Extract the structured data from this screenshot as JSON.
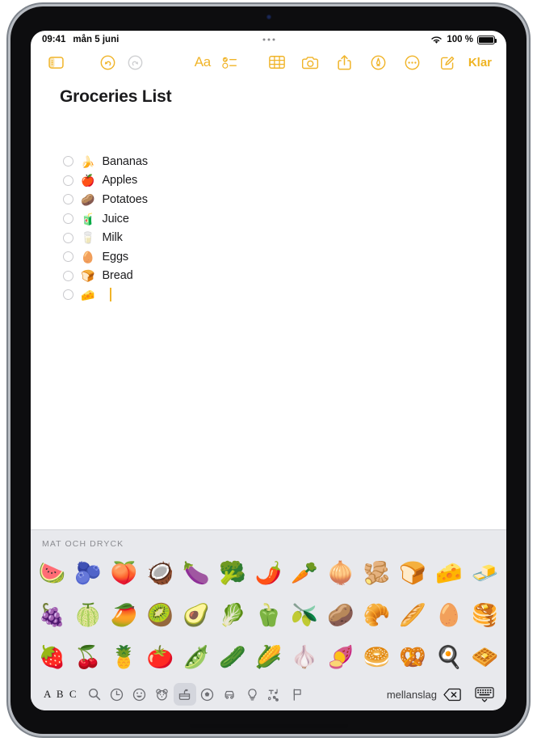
{
  "status_bar": {
    "time": "09:41",
    "date": "mån 5 juni",
    "wifi_icon": "wifi-icon",
    "battery_percent": "100 %",
    "battery_icon": "battery-icon",
    "multitask_icon": "multitasking-dots-icon"
  },
  "toolbar": {
    "sidebar_icon": "sidebar-toggle-icon",
    "undo_icon": "undo-icon",
    "redo_icon": "redo-icon",
    "format_label": "Aa",
    "checklist_icon": "checklist-icon",
    "table_icon": "table-icon",
    "camera_icon": "camera-icon",
    "share_icon": "share-icon",
    "markup_icon": "markup-pen-icon",
    "more_icon": "more-ellipsis-icon",
    "compose_icon": "compose-icon",
    "done_label": "Klar",
    "accent_color": "#f0b429"
  },
  "note": {
    "title": "Groceries List",
    "items": [
      {
        "emoji": "🍌",
        "text": "Bananas",
        "checked": false
      },
      {
        "emoji": "🍎",
        "text": "Apples",
        "checked": false
      },
      {
        "emoji": "🥔",
        "text": "Potatoes",
        "checked": false
      },
      {
        "emoji": "🧃",
        "text": "Juice",
        "checked": false
      },
      {
        "emoji": "🥛",
        "text": "Milk",
        "checked": false
      },
      {
        "emoji": "🥚",
        "text": "Eggs",
        "checked": false
      },
      {
        "emoji": "🍞",
        "text": "Bread",
        "checked": false
      },
      {
        "emoji": "🧀",
        "text": "",
        "checked": false
      }
    ]
  },
  "keyboard": {
    "section_title": "MAT OCH DRYCK",
    "emoji_rows": [
      [
        "🍉",
        "🫐",
        "🍑",
        "🥥",
        "🍆",
        "🥦",
        "🌶️",
        "🥕",
        "🧅",
        "🫚",
        "🍞",
        "🧀",
        "🧈"
      ],
      [
        "🍇",
        "🍈",
        "🥭",
        "🥝",
        "🥑",
        "🥬",
        "🫑",
        "🫒",
        "🥔",
        "🥐",
        "🥖",
        "🥚",
        "🥞"
      ],
      [
        "🍓",
        "🍒",
        "🍍",
        "🍅",
        "🫛",
        "🥒",
        "🌽",
        "🧄",
        "🍠",
        "🥯",
        "🥨",
        "🍳",
        "🧇"
      ]
    ],
    "abc_label": "A B C",
    "space_label": "mellanslag",
    "categories": [
      {
        "name": "search-icon",
        "glyph": "",
        "selected": false
      },
      {
        "name": "recents-clock-icon",
        "glyph": "",
        "selected": false
      },
      {
        "name": "smileys-icon",
        "glyph": "",
        "selected": false
      },
      {
        "name": "animals-icon",
        "glyph": "",
        "selected": false
      },
      {
        "name": "food-drink-icon",
        "glyph": "",
        "selected": true
      },
      {
        "name": "activity-icon",
        "glyph": "",
        "selected": false
      },
      {
        "name": "travel-icon",
        "glyph": "",
        "selected": false
      },
      {
        "name": "objects-icon",
        "glyph": "",
        "selected": false
      },
      {
        "name": "symbols-icon",
        "glyph": "",
        "selected": false
      },
      {
        "name": "flags-icon",
        "glyph": "",
        "selected": false
      }
    ],
    "delete_icon": "delete-backward-icon",
    "hide_keyboard_icon": "hide-keyboard-icon"
  }
}
